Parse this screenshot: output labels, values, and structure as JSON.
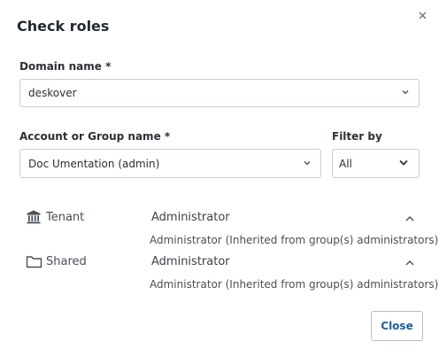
{
  "dialog": {
    "title": "Check roles",
    "close_icon": "close-icon"
  },
  "domain": {
    "label": "Domain name *",
    "value": "deskover"
  },
  "account": {
    "label": "Account or Group name *",
    "value": "Doc Umentation (admin)"
  },
  "filter": {
    "label": "Filter by",
    "value": "All"
  },
  "roles": [
    {
      "icon": "bank-icon",
      "name": "Tenant",
      "role": "Administrator",
      "detail": "Administrator (Inherited from group(s) administrators)"
    },
    {
      "icon": "folder-icon",
      "name": "Shared",
      "role": "Administrator",
      "detail": "Administrator (Inherited from group(s) administrators)"
    }
  ],
  "footer": {
    "close_label": "Close"
  }
}
